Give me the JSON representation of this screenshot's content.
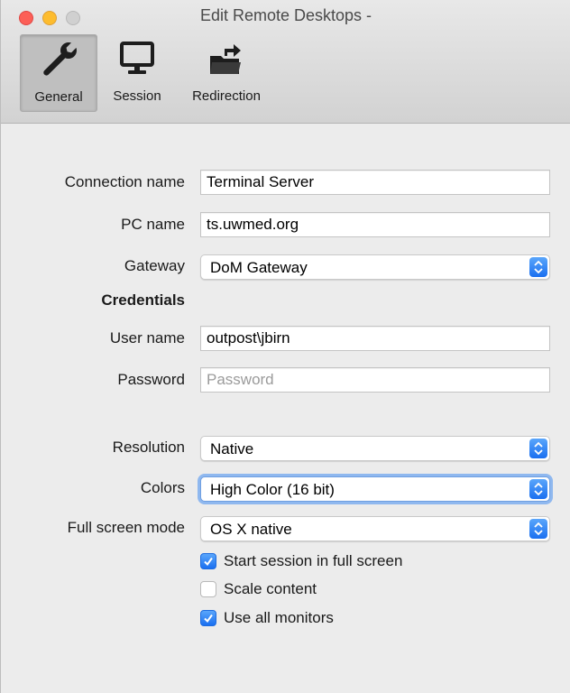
{
  "window": {
    "title": "Edit Remote Desktops -"
  },
  "tabs": [
    {
      "label": "General",
      "icon": "wrench-icon",
      "selected": true
    },
    {
      "label": "Session",
      "icon": "monitor-icon",
      "selected": false
    },
    {
      "label": "Redirection",
      "icon": "folder-redirect-icon",
      "selected": false
    }
  ],
  "form": {
    "connection_name": {
      "label": "Connection name",
      "value": "Terminal Server"
    },
    "pc_name": {
      "label": "PC name",
      "value": "ts.uwmed.org"
    },
    "gateway": {
      "label": "Gateway",
      "value": "DoM Gateway"
    },
    "credentials_heading": "Credentials",
    "user_name": {
      "label": "User name",
      "value": "outpost\\jbirn"
    },
    "password": {
      "label": "Password",
      "value": "",
      "placeholder": "Password"
    },
    "resolution": {
      "label": "Resolution",
      "value": "Native"
    },
    "colors": {
      "label": "Colors",
      "value": "High Color (16 bit)"
    },
    "full_screen_mode": {
      "label": "Full screen mode",
      "value": "OS X native"
    },
    "checkboxes": [
      {
        "label": "Start session in full screen",
        "checked": true
      },
      {
        "label": "Scale content",
        "checked": false
      },
      {
        "label": "Use all monitors",
        "checked": true
      }
    ]
  },
  "colors": {
    "accent": "#1a6ff0",
    "close": "#fc5f57",
    "minimize": "#fdbc2e",
    "maximize": "#d0d0d0"
  }
}
